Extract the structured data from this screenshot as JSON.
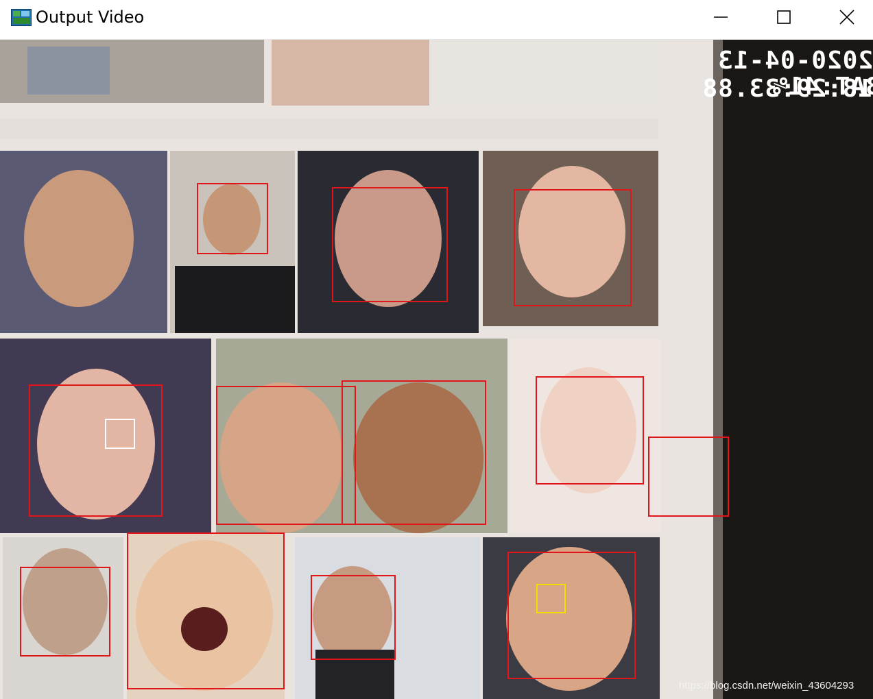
{
  "window": {
    "title": "Output Video",
    "icon": "video-app-icon",
    "controls": {
      "minimize": "minimize-icon",
      "maximize": "maximize-icon",
      "close": "close-icon"
    }
  },
  "video": {
    "timestamp": "2020-04-13 18:29:33.88",
    "battery": "BAT:41%",
    "watermark": "https://blog.csdn.net/weixin_43604293",
    "colors": {
      "face_box": "#e0161a",
      "eye_box_white": "#ffffff",
      "eye_box_yellow": "#f0e000"
    }
  }
}
